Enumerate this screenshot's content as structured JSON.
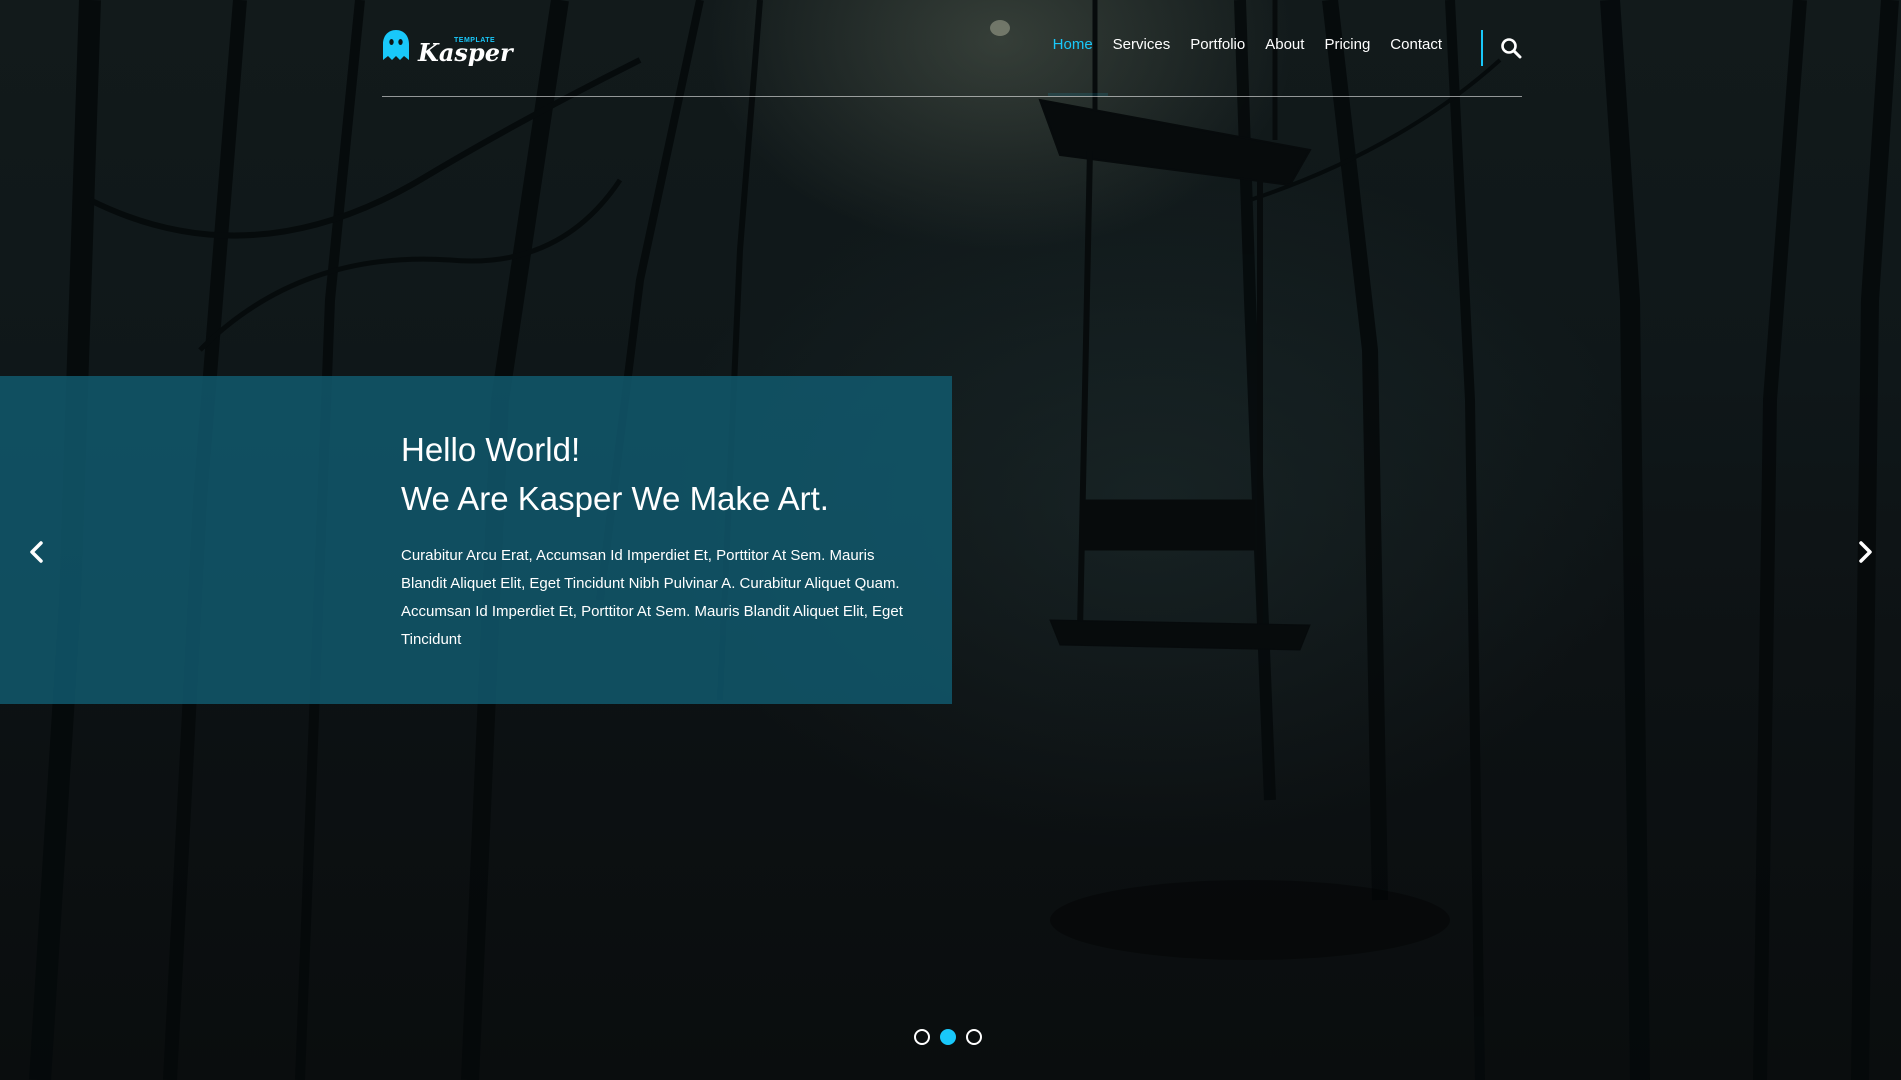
{
  "brand": {
    "name": "Kasper",
    "tagline": "TEMPLATE",
    "accent_color": "#19c8fa"
  },
  "nav": {
    "items": [
      {
        "label": "Home",
        "active": true
      },
      {
        "label": "Services",
        "active": false
      },
      {
        "label": "Portfolio",
        "active": false
      },
      {
        "label": "About",
        "active": false
      },
      {
        "label": "Pricing",
        "active": false
      },
      {
        "label": "Contact",
        "active": false
      }
    ],
    "search_icon": "search-icon"
  },
  "hero": {
    "title_line_1": "Hello World!",
    "title_line_2": "We Are Kasper We Make Art.",
    "text": "Curabitur Arcu Erat, Accumsan Id Imperdiet Et, Porttitor At Sem. Mauris Blandit Aliquet Elit, Eget Tincidunt Nibh Pulvinar A. Curabitur Aliquet Quam. Accumsan Id Imperdiet Et, Porttitor At Sem. Mauris Blandit Aliquet Elit, Eget Tincidunt",
    "panel_color": "#115b70"
  },
  "slider": {
    "prev_icon": "chevron-left-icon",
    "next_icon": "chevron-right-icon",
    "bullets": [
      {
        "active": false
      },
      {
        "active": true
      },
      {
        "active": false
      }
    ]
  }
}
